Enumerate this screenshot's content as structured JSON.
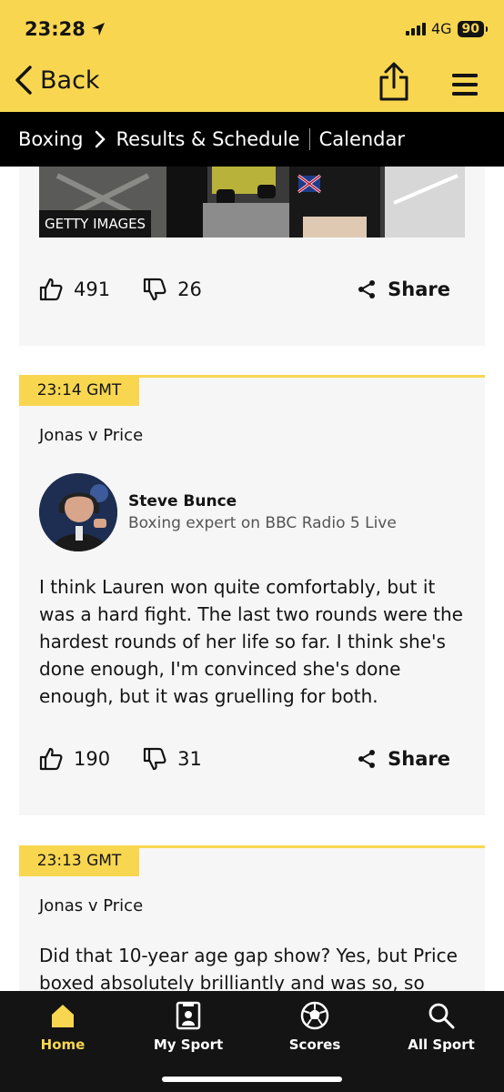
{
  "status_bar": {
    "time": "23:28",
    "network": "4G",
    "battery": "90"
  },
  "nav": {
    "back_label": "Back"
  },
  "breadcrumb": {
    "section": "Boxing",
    "page": "Results & Schedule",
    "extra": "Calendar"
  },
  "posts": [
    {
      "image_credit": "GETTY IMAGES",
      "likes": "491",
      "dislikes": "26",
      "share_label": "Share"
    },
    {
      "time": "23:14 GMT",
      "topic": "Jonas v Price",
      "author_name": "Steve Bunce",
      "author_role": "Boxing expert on BBC Radio 5 Live",
      "text": "I think Lauren won quite comfortably, but it was a hard fight. The last two rounds were the hardest rounds of her life so far. I think she's done enough, I'm convinced she's done enough, but it was gruelling for both.",
      "likes": "190",
      "dislikes": "31",
      "share_label": "Share"
    },
    {
      "time": "23:13 GMT",
      "topic": "Jonas v Price",
      "text": "Did that 10-year age gap show? Yes, but Price boxed absolutely brilliantly and was so, so"
    }
  ],
  "tabbar": {
    "home": "Home",
    "my_sport": "My Sport",
    "scores": "Scores",
    "all_sport": "All Sport"
  },
  "colors": {
    "accent": "#f8d650",
    "dark": "#141414",
    "card": "#f6f6f6"
  }
}
